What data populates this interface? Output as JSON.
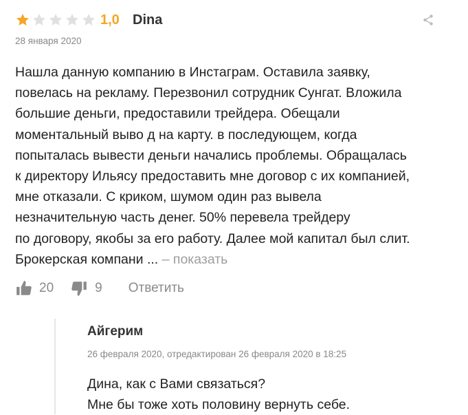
{
  "review": {
    "rating": "1,0",
    "stars_filled": 1,
    "stars_total": 5,
    "author": "Dina",
    "date": "28 января 2020",
    "text_lines": [
      "Нашла данную компанию в Инстаграм. Оставила заявку,",
      "повелась на рекламу. Перезвонил сотрудник Сунгат. Вложила",
      "большие деньги, предоставили трейдера. Обещали",
      "моментальный выво д на карту. в последующем, когда",
      "попыталась вывести деньги начались проблемы. Обращалась",
      "к директору Ильясу предоставить мне договор с их компанией,",
      "мне отказали. С криком, шумом один раз вывела",
      "незначительную часть денег. 50% перевела трейдеру",
      "по договору, якобы за его работу. Далее мой капитал был слит."
    ],
    "last_line": "Брокерская компани ... ",
    "show_more": "– показать",
    "likes": "20",
    "dislikes": "9",
    "reply_label": "Ответить"
  },
  "reply": {
    "author": "Айгерим",
    "date": "26 февраля 2020, отредактирован 26 февраля 2020 в 18:25",
    "text_lines": [
      "Дина, как с Вами связаться?",
      "Мне бы тоже хоть половину вернуть себе."
    ]
  },
  "colors": {
    "star_filled": "#f5a623",
    "star_empty": "#e0e0e0",
    "icon_grey": "#8a8a8a"
  },
  "icons": [
    "star-icon",
    "share-icon",
    "thumbs-up-icon",
    "thumbs-down-icon"
  ]
}
